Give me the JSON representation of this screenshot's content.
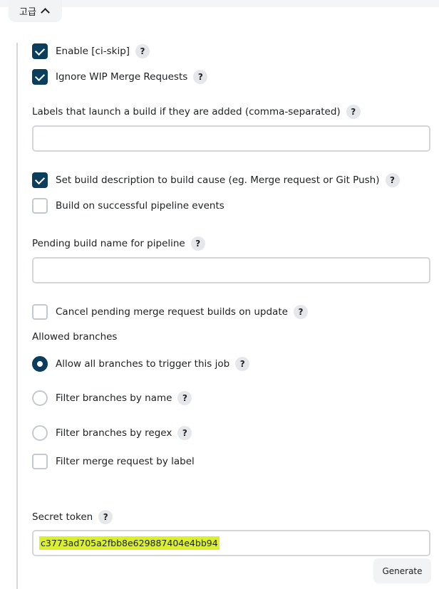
{
  "advanced": {
    "label": "고급"
  },
  "options": {
    "enable_ci_skip": {
      "label": "Enable [ci-skip]",
      "checked": true
    },
    "ignore_wip": {
      "label": "Ignore WIP Merge Requests",
      "checked": true
    },
    "labels_field": {
      "label": "Labels that launch a build if they are added (comma-separated)",
      "value": ""
    },
    "set_build_description": {
      "label": "Set build description to build cause (eg. Merge request or Git Push)",
      "checked": true
    },
    "build_on_pipeline": {
      "label": "Build on successful pipeline events",
      "checked": false
    },
    "pending_build_name": {
      "label": "Pending build name for pipeline",
      "value": ""
    },
    "cancel_pending": {
      "label": "Cancel pending merge request builds on update",
      "checked": false
    }
  },
  "allowed_branches": {
    "title": "Allowed branches",
    "selected": "all",
    "choices": [
      {
        "id": "all",
        "label": "Allow all branches to trigger this job",
        "has_help": true
      },
      {
        "id": "by_name",
        "label": "Filter branches by name",
        "has_help": true
      },
      {
        "id": "by_regex",
        "label": "Filter branches by regex",
        "has_help": true
      }
    ],
    "filter_by_label": {
      "label": "Filter merge request by label",
      "checked": false
    }
  },
  "secret_token": {
    "label": "Secret token",
    "value": "c3773ad705a2fbb8e629887404e4bb94",
    "generate_label": "Generate"
  },
  "help_glyph": "?"
}
